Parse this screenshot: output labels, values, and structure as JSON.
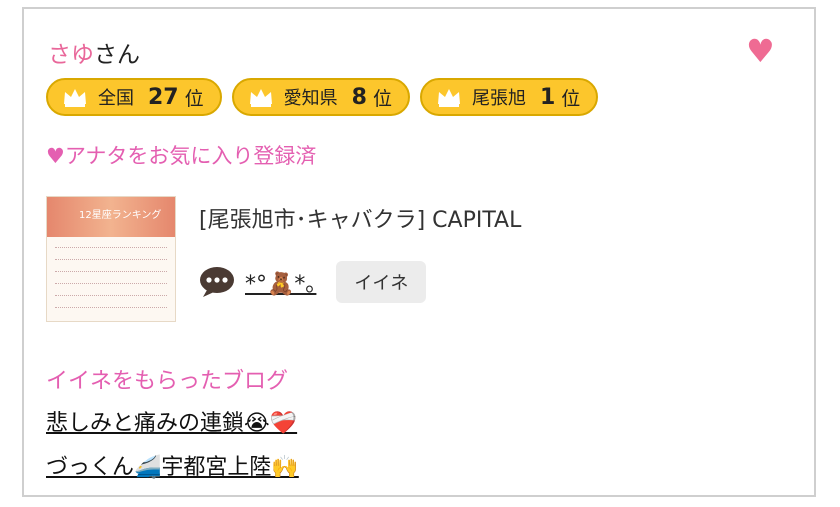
{
  "user": {
    "name": "さゆ",
    "suffix": "さん"
  },
  "favorite_icon": "heart-icon",
  "ranks": [
    {
      "label": "全国",
      "number": "27",
      "unit": "位"
    },
    {
      "label": "愛知県",
      "number": "8",
      "unit": "位"
    },
    {
      "label": "尾張旭",
      "number": "1",
      "unit": "位"
    }
  ],
  "favorite_status": "♥アナタをお気に入り登録済",
  "shop": "[尾張旭市･キャバクラ]  CAPITAL",
  "thumbnail_title": "12星座ランキング",
  "comment_text": "*°🧸*｡",
  "iine_button": "イイネ",
  "blogs_heading": "イイネをもらったブログ",
  "blogs": [
    {
      "title": "悲しみと痛みの連鎖😭❤️‍🩹"
    },
    {
      "title": "づっくん🚄宇都宮上陸🙌"
    }
  ],
  "colors": {
    "accent_pink": "#e45fb1",
    "name_pink": "#e9679a",
    "badge_yellow": "#fcc62c"
  }
}
